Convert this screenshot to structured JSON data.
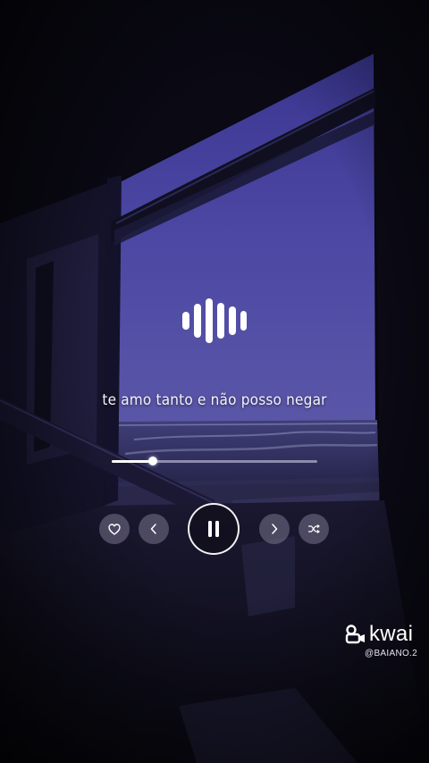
{
  "lyric": "te amo tanto e não posso negar",
  "player": {
    "progress": 0.2,
    "state": "playing",
    "buttons": [
      {
        "name": "like-button",
        "icon": "heart-icon"
      },
      {
        "name": "previous-button",
        "icon": "chevron-left-icon"
      },
      {
        "name": "pause-button",
        "icon": "pause-icon"
      },
      {
        "name": "next-button",
        "icon": "chevron-right-icon"
      },
      {
        "name": "shuffle-button",
        "icon": "shuffle-icon"
      }
    ]
  },
  "watermark": {
    "brand": "kwai",
    "handle": "@BAIANO.2"
  },
  "colors": {
    "sky": "#4a4598",
    "sea": "#3b3a6e",
    "frame": "#07060d",
    "accent": "#ffffff"
  }
}
